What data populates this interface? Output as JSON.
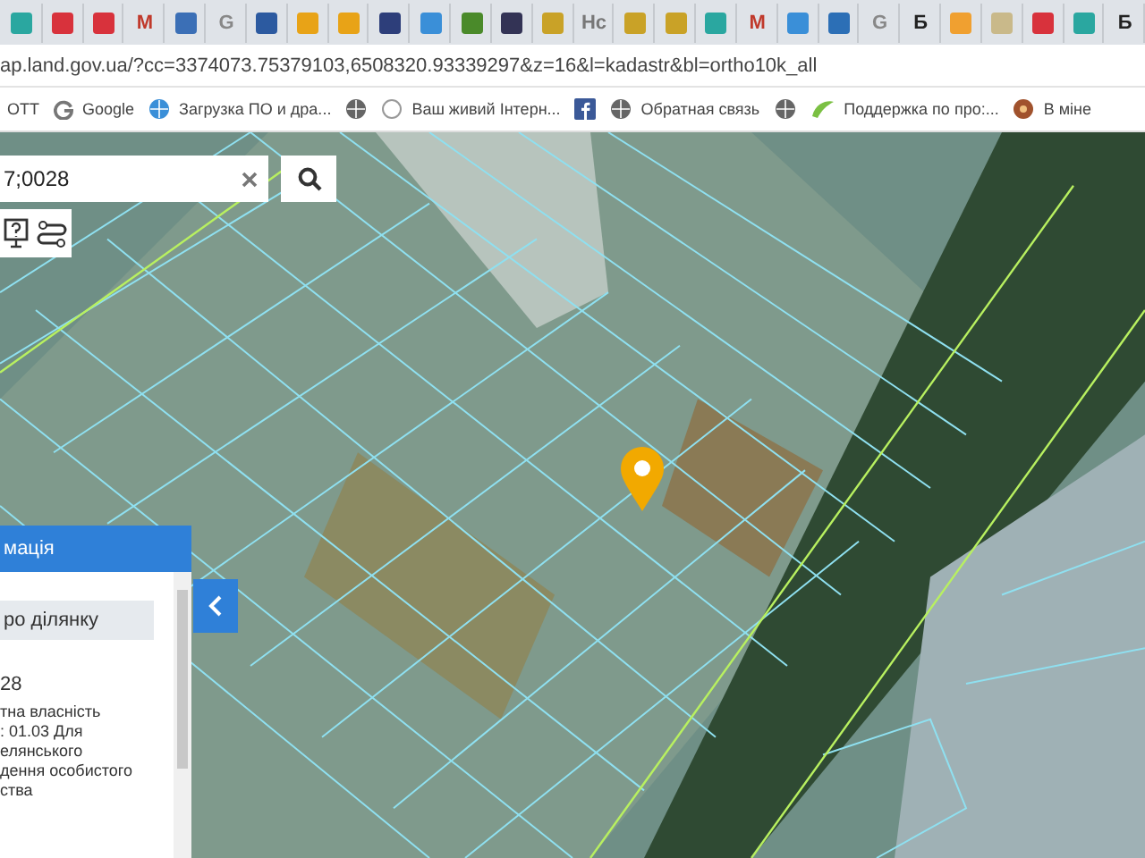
{
  "tabs": [
    {
      "kind": "icon",
      "color": "#2aa7a0",
      "selected": false
    },
    {
      "kind": "icon",
      "color": "#d8323c",
      "selected": false
    },
    {
      "kind": "icon",
      "color": "#d8323c",
      "selected": false
    },
    {
      "kind": "text",
      "label": "M",
      "color": "#c0392b",
      "selected": false
    },
    {
      "kind": "icon",
      "color": "#3b6fb6",
      "selected": false
    },
    {
      "kind": "text",
      "label": "G",
      "color": "#888888",
      "selected": false
    },
    {
      "kind": "icon",
      "color": "#2c5aa0",
      "selected": false
    },
    {
      "kind": "icon",
      "color": "#e8a317",
      "selected": false
    },
    {
      "kind": "icon",
      "color": "#e8a317",
      "selected": false
    },
    {
      "kind": "icon",
      "color": "#2d3e7a",
      "selected": false
    },
    {
      "kind": "icon",
      "color": "#3a8fd8",
      "selected": false
    },
    {
      "kind": "icon",
      "color": "#4a8a2a",
      "selected": false
    },
    {
      "kind": "icon",
      "color": "#333355",
      "selected": false
    },
    {
      "kind": "icon",
      "color": "#c9a227",
      "selected": false
    },
    {
      "kind": "text",
      "label": "Нс",
      "color": "#777777",
      "selected": false
    },
    {
      "kind": "icon",
      "color": "#c9a227",
      "selected": false
    },
    {
      "kind": "icon",
      "color": "#c9a227",
      "selected": false
    },
    {
      "kind": "icon",
      "color": "#2aa7a0",
      "selected": false
    },
    {
      "kind": "text",
      "label": "M",
      "color": "#c0392b",
      "selected": false
    },
    {
      "kind": "icon",
      "color": "#3a8fd8",
      "selected": false
    },
    {
      "kind": "icon",
      "color": "#2c6fb6",
      "selected": false
    },
    {
      "kind": "text",
      "label": "G",
      "color": "#888888",
      "selected": false
    },
    {
      "kind": "text",
      "label": "Б",
      "color": "#222222",
      "selected": false
    },
    {
      "kind": "icon",
      "color": "#f0a030",
      "selected": false
    },
    {
      "kind": "icon",
      "color": "#c9b98a",
      "selected": false
    },
    {
      "kind": "icon",
      "color": "#d8323c",
      "selected": false
    },
    {
      "kind": "icon",
      "color": "#2aa7a0",
      "selected": false
    },
    {
      "kind": "text",
      "label": "Б",
      "color": "#222222",
      "selected": false
    }
  ],
  "address_bar": {
    "url": "ap.land.gov.ua/?cc=3374073.75379103,6508320.93339297&z=16&l=kadastr&bl=ortho10k_all"
  },
  "bookmarks": [
    {
      "label": "ОТТ",
      "kind": "none"
    },
    {
      "label": "Google",
      "kind": "google"
    },
    {
      "label": "Загрузка ПО и дра...",
      "kind": "globe-blue"
    },
    {
      "kind": "globe"
    },
    {
      "label": "Ваш живий Інтерн...",
      "kind": "circle"
    },
    {
      "kind": "facebook"
    },
    {
      "label": "Обратная связь",
      "kind": "globe"
    },
    {
      "kind": "globe"
    },
    {
      "label": "Поддержка по про:...",
      "kind": "green"
    },
    {
      "label": "В міне",
      "kind": "brown"
    }
  ],
  "search": {
    "value": "7;0028"
  },
  "info_panel": {
    "title": "мація",
    "section_button": "ро ділянку",
    "lines": [
      "28",
      "тна власність",
      ": 01.03 Для",
      "елянського",
      "дення особистого",
      "ства"
    ]
  }
}
